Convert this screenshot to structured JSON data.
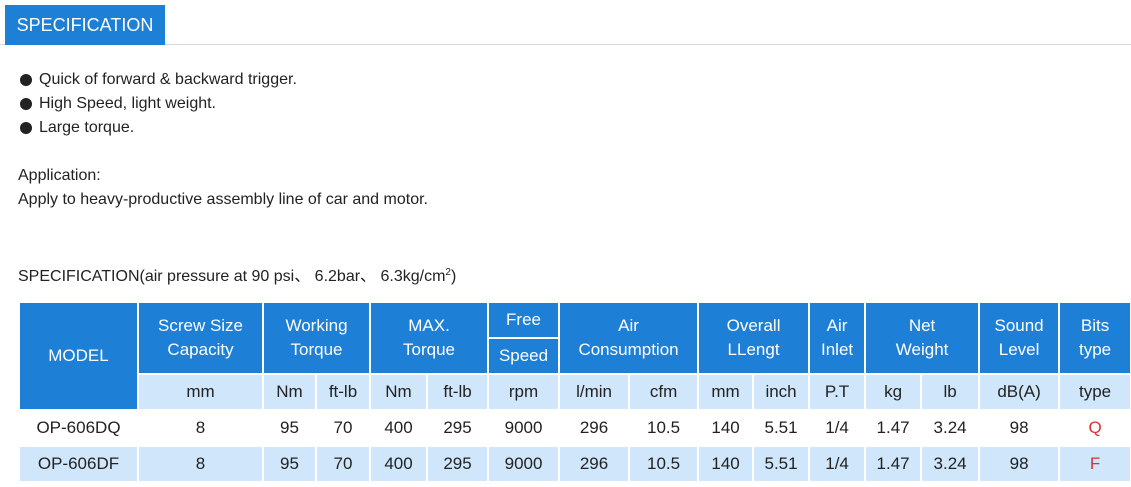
{
  "tab": {
    "label": "SPECIFICATION"
  },
  "features": [
    "Quick of forward & backward trigger.",
    "High Speed, light weight.",
    "Large torque."
  ],
  "application": {
    "title": "Application:",
    "text": "Apply to heavy-productive assembly line of car and motor."
  },
  "spec": {
    "heading_main": "SPECIFICATION(air pressure at 90 psi、 6.2bar、 6.3kg/cm",
    "heading_sup": "2",
    "heading_tail": ")"
  },
  "table": {
    "headers": {
      "model": "MODEL",
      "screw_1": "Screw Size",
      "screw_2": "Capacity",
      "working_1": "Working",
      "working_2": "Torque",
      "max_1": "MAX.",
      "max_2": "Torque",
      "free_1": "Free",
      "free_2": "Speed",
      "air_1": "Air",
      "air_2": "Consumption",
      "overall_1": "Overall",
      "overall_2": "LLengt",
      "inlet_1": "Air",
      "inlet_2": "Inlet",
      "net_1": "Net",
      "net_2": "Weight",
      "sound_1": "Sound",
      "sound_2": "Level",
      "bits_1": "Bits",
      "bits_2": "type"
    },
    "units": [
      "mm",
      "Nm",
      "ft-lb",
      "Nm",
      "ft-lb",
      "rpm",
      "l/min",
      "cfm",
      "mm",
      "inch",
      "P.T",
      "kg",
      "lb",
      "dB(A)",
      "type"
    ],
    "rows": [
      [
        "OP-606DQ",
        "8",
        "95",
        "70",
        "400",
        "295",
        "9000",
        "296",
        "10.5",
        "140",
        "5.51",
        "1/4",
        "1.47",
        "3.24",
        "98",
        "Q"
      ],
      [
        "OP-606DF",
        "8",
        "95",
        "70",
        "400",
        "295",
        "9000",
        "296",
        "10.5",
        "140",
        "5.51",
        "1/4",
        "1.47",
        "3.24",
        "98",
        "F"
      ]
    ],
    "colors": {
      "header": "#1e7fd6",
      "unit_row": "#cfe6fb",
      "type_text": "#e03030"
    }
  }
}
